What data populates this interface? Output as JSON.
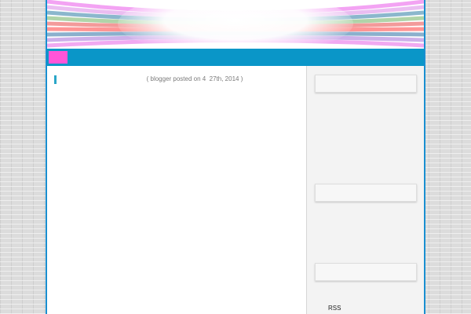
{
  "post": {
    "meta": "( blogger posted on 4  27th, 2014 )"
  },
  "sidebar": {
    "rss_label": "RSS"
  },
  "colors": {
    "frame_border": "#1a8fd0",
    "nav_bar": "#0a96c8",
    "nav_block": "#ff55d8",
    "title_marker": "#2aa6c8"
  },
  "icons": {
    "header_banner": "rainbow-stripes-banner"
  }
}
